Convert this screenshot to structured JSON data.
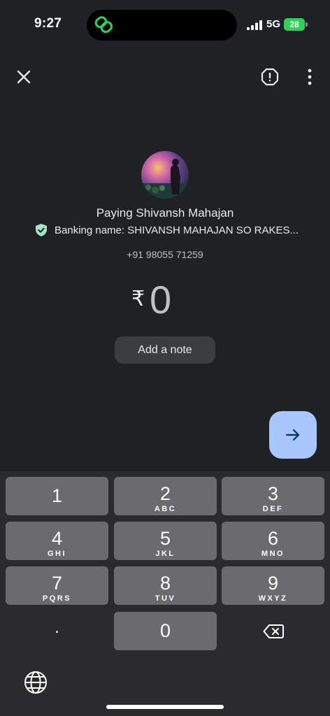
{
  "status_bar": {
    "time": "9:27",
    "network": "5G",
    "battery": "28",
    "island_icon": "link-rings-icon",
    "colors": {
      "battery": "#30d158",
      "island_icon": "#30d158"
    }
  },
  "top_bar": {
    "close_icon": "close-icon",
    "report_icon": "report-icon",
    "more_icon": "more-vert-icon"
  },
  "payee": {
    "paying_label": "Paying Shivansh Mahajan",
    "banking_name": "Banking name: SHIVANSH MAHAJAN SO RAKES...",
    "phone": "+91 98055 71259",
    "verified_icon": "verified-shield-icon"
  },
  "amount": {
    "currency": "₹",
    "value": "0"
  },
  "note_button": {
    "label": "Add a note"
  },
  "next_button": {
    "icon": "arrow-right-icon",
    "color": "#a8c7fa"
  },
  "keypad": {
    "keys": [
      {
        "digit": "1",
        "letters": ""
      },
      {
        "digit": "2",
        "letters": "ABC"
      },
      {
        "digit": "3",
        "letters": "DEF"
      },
      {
        "digit": "4",
        "letters": "GHI"
      },
      {
        "digit": "5",
        "letters": "JKL"
      },
      {
        "digit": "6",
        "letters": "MNO"
      },
      {
        "digit": "7",
        "letters": "PQRS"
      },
      {
        "digit": "8",
        "letters": "TUV"
      },
      {
        "digit": "9",
        "letters": "WXYZ"
      },
      {
        "digit": ".",
        "letters": ""
      },
      {
        "digit": "0",
        "letters": ""
      }
    ],
    "backspace_icon": "backspace-icon",
    "globe_icon": "globe-icon"
  }
}
